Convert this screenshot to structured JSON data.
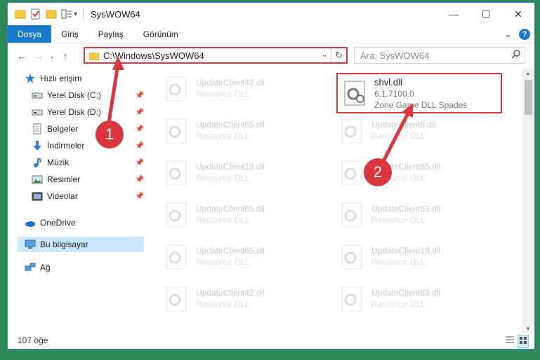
{
  "window": {
    "title": "SysWOW64",
    "controls": {
      "minimize": "—",
      "maximize": "☐",
      "close": "✕"
    }
  },
  "ribbon": {
    "tabs": [
      {
        "label": "Dosya",
        "active": true
      },
      {
        "label": "Giriş",
        "active": false
      },
      {
        "label": "Paylaş",
        "active": false
      },
      {
        "label": "Görünüm",
        "active": false
      }
    ],
    "collapse_glyph": "⌄",
    "help_glyph": "?"
  },
  "navigation": {
    "back_glyph": "←",
    "forward_glyph": "→",
    "recent_glyph": "⌄",
    "up_glyph": "↑",
    "address": "C:\\Windows\\SysWOW64",
    "address_dropdown_glyph": "⌄",
    "refresh_glyph": "↻",
    "search_placeholder": "Ara: SysWOW64",
    "search_icon": "search-icon"
  },
  "sidebar": {
    "items": [
      {
        "label": "Hızlı erişim",
        "icon": "star-icon"
      },
      {
        "label": "Yerel Disk (C:)",
        "icon": "drive-icon",
        "pinned": true
      },
      {
        "label": "Yerel Disk (D:)",
        "icon": "drive-icon",
        "pinned": true
      },
      {
        "label": "Belgeler",
        "icon": "documents-icon",
        "pinned": true
      },
      {
        "label": "İndirmeler",
        "icon": "download-icon",
        "pinned": true
      },
      {
        "label": "Müzik",
        "icon": "music-icon",
        "pinned": true
      },
      {
        "label": "Resimler",
        "icon": "pictures-icon",
        "pinned": true
      },
      {
        "label": "Videolar",
        "icon": "videos-icon",
        "pinned": true
      },
      {
        "label": "OneDrive",
        "icon": "cloud-icon"
      },
      {
        "label": "Bu bilgisayar",
        "icon": "computer-icon",
        "selected": true
      },
      {
        "label": "Ağ",
        "icon": "network-icon"
      }
    ]
  },
  "files": {
    "left_column": [
      {
        "name": "UpdateClient42.dll",
        "type": "Resource DLL"
      },
      {
        "name": "UpdateClient65.dll",
        "type": "Resource DLL"
      },
      {
        "name": "UpdateClient19.dll",
        "type": "Resource DLL"
      },
      {
        "name": "UpdateClient65.dll",
        "type": "Resource DLL"
      },
      {
        "name": "UpdateClient65.dll",
        "type": "Resource DLL"
      },
      {
        "name": "UpdateClient42.dll",
        "type": "Resource DLL"
      }
    ],
    "highlight": {
      "name": "shvl.dll",
      "version": "6.1.7100.0",
      "description": "Zone Game DLL  Spades"
    },
    "right_column": [
      {
        "name": "UpdateClient5.dll",
        "type": "Resource DLL"
      },
      {
        "name": "UpdateClient65.dll",
        "type": "Resource DLL"
      },
      {
        "name": "UpdateClient63.dll",
        "type": "Resource DLL"
      },
      {
        "name": "UpdateClient19.dll",
        "type": "Resource DLL"
      },
      {
        "name": "UpdateClient63.dll",
        "type": "Resource DLL"
      }
    ]
  },
  "status": {
    "item_count": "107 öğe"
  },
  "annotations": {
    "step1": "1",
    "step2": "2",
    "color": "#d9363e"
  }
}
